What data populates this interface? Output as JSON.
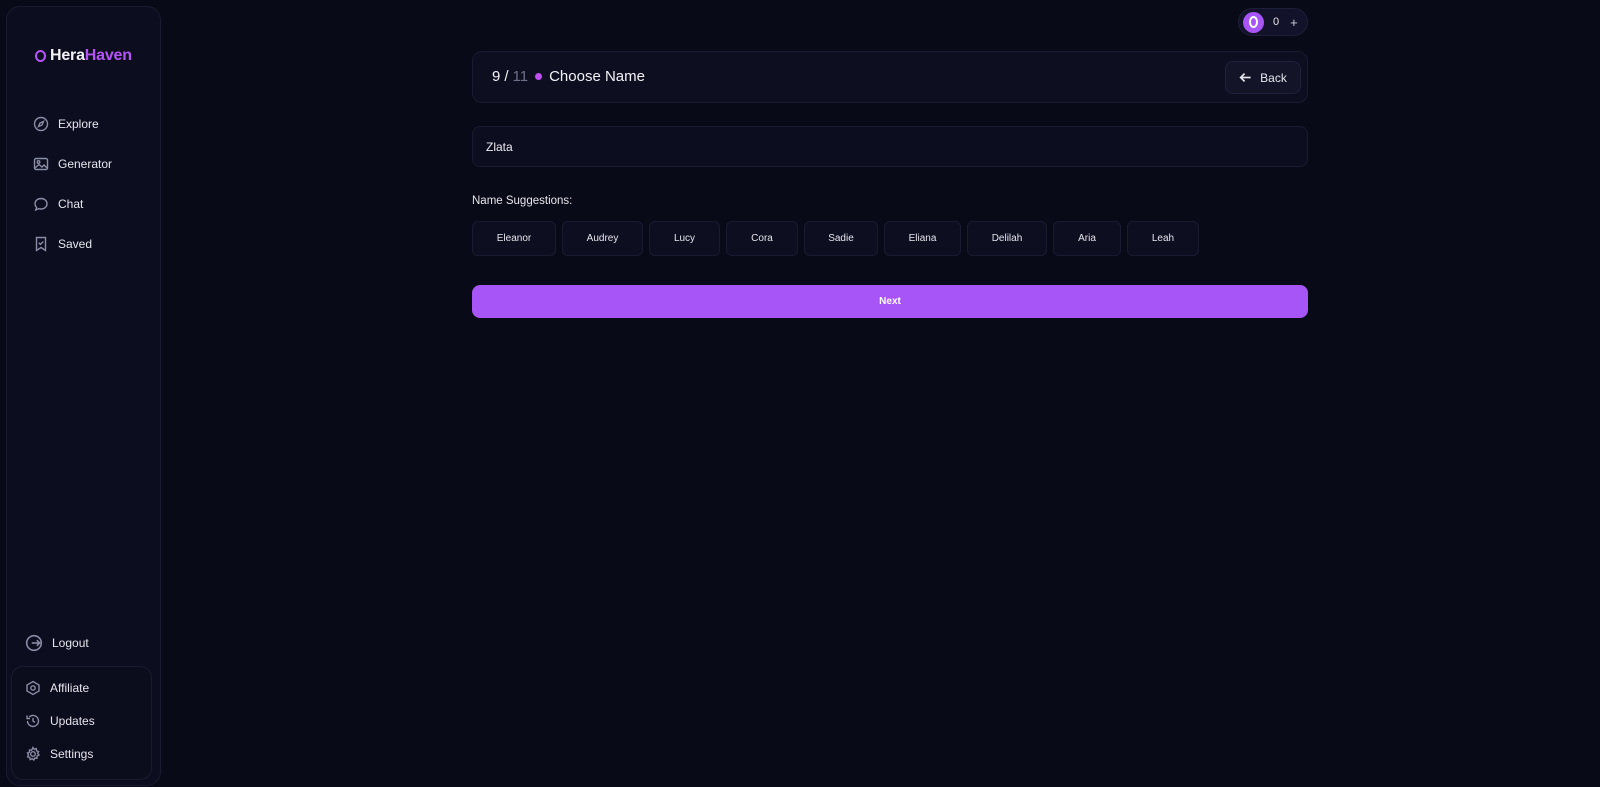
{
  "brand": {
    "part1": "Hera",
    "part2": "Haven"
  },
  "nav": {
    "items": [
      {
        "label": "Explore",
        "icon": "compass-icon"
      },
      {
        "label": "Generator",
        "icon": "image-icon"
      },
      {
        "label": "Chat",
        "icon": "chat-icon"
      },
      {
        "label": "Saved",
        "icon": "bookmark-icon"
      }
    ],
    "logout": "Logout",
    "bottom": [
      {
        "label": "Affiliate",
        "icon": "affiliate-icon"
      },
      {
        "label": "Updates",
        "icon": "history-icon"
      },
      {
        "label": "Settings",
        "icon": "gear-icon"
      }
    ]
  },
  "credits": {
    "count": "0",
    "add": "+"
  },
  "step": {
    "current": "9",
    "separator": "/",
    "total": "11",
    "title": "Choose Name",
    "back_label": "Back"
  },
  "name_input": {
    "value": "Zlata"
  },
  "suggestions": {
    "label": "Name Suggestions:",
    "names": [
      "Eleanor",
      "Audrey",
      "Lucy",
      "Cora",
      "Sadie",
      "Eliana",
      "Delilah",
      "Aria",
      "Leah"
    ]
  },
  "next_label": "Next",
  "colors": {
    "accent": "#a855f7",
    "background": "#090a17",
    "panel": "#0c0d1e"
  }
}
